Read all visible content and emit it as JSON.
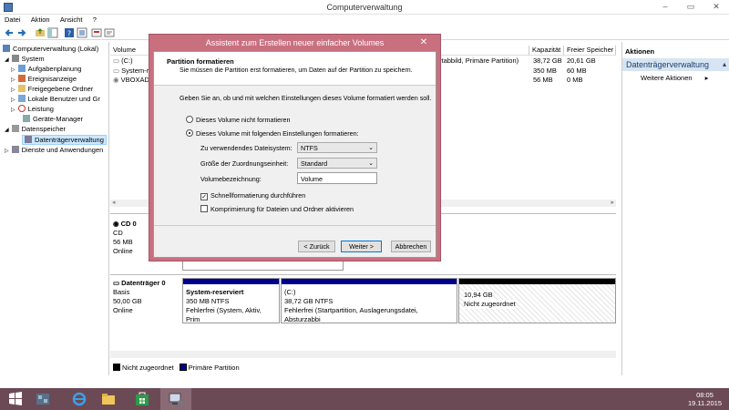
{
  "window": {
    "title": "Computerverwaltung",
    "minimize": "–",
    "maximize": "▭",
    "close": "✕"
  },
  "menu": [
    "Datei",
    "Aktion",
    "Ansicht",
    "?"
  ],
  "tree": {
    "root": "Computerverwaltung (Lokal)",
    "system": "System",
    "items": [
      "Aufgabenplanung",
      "Ereignisanzeige",
      "Freigegebene Ordner",
      "Lokale Benutzer und Gr",
      "Leistung",
      "Geräte-Manager"
    ],
    "storage": "Datenspeicher",
    "disk_mgmt": "Datenträgerverwaltung",
    "services": "Dienste und Anwendungen"
  },
  "volumes": {
    "headers": {
      "volume": "Volume",
      "capacity": "Kapazität",
      "free": "Freier Speicher"
    },
    "rows": [
      {
        "name": "(C:)",
        "status": "rtabbild, Primäre Partition)",
        "capacity": "38,72 GB",
        "free": "20,61 GB"
      },
      {
        "name": "System-r",
        "status": "",
        "capacity": "350 MB",
        "free": "60 MB"
      },
      {
        "name": "VBOXAD",
        "status": "",
        "capacity": "56 MB",
        "free": "0 MB"
      }
    ]
  },
  "cd": {
    "name": "CD 0",
    "type": "CD",
    "size": "56 MB",
    "status": "Online"
  },
  "disk": {
    "name": "Datenträger 0",
    "type": "Basis",
    "size": "50,00 GB",
    "status": "Online",
    "partitions": [
      {
        "name": "System-reserviert",
        "size": "350 MB NTFS",
        "status": "Fehlerfrei (System, Aktiv, Prim"
      },
      {
        "name": "(C:)",
        "size": "38,72 GB NTFS",
        "status": "Fehlerfrei (Startpartition, Auslagerungsdatei, Absturzabbi"
      },
      {
        "name": "",
        "size": "10,94 GB",
        "status": "Nicht zugeordnet"
      }
    ]
  },
  "legend": {
    "unassigned": "Nicht zugeordnet",
    "primary": "Primäre Partition"
  },
  "actions": {
    "header": "Aktionen",
    "section": "Datenträgerverwaltung",
    "more": "Weitere Aktionen"
  },
  "dialog": {
    "title": "Assistent zum Erstellen neuer einfacher Volumes",
    "heading": "Partition formatieren",
    "subheading": "Sie müssen die Partition erst formatieren, um Daten auf der Partition zu speichern.",
    "prompt": "Geben Sie an, ob und mit welchen Einstellungen dieses Volume formatiert werden soll.",
    "radio_noformat": "Dieses Volume nicht formatieren",
    "radio_format": "Dieses Volume mit folgenden Einstellungen formatieren:",
    "fs_label": "Zu verwendendes Dateisystem:",
    "fs_value": "NTFS",
    "alloc_label": "Größe der Zuordnungseinheit:",
    "alloc_value": "Standard",
    "vol_label": "Volumebezeichnung:",
    "vol_value": "Volume",
    "quick_format": "Schnellformatierung durchführen",
    "compress": "Komprimierung für Dateien und Ordner aktivieren",
    "back": "< Zurück",
    "next": "Weiter >",
    "cancel": "Abbrechen"
  },
  "clock": {
    "time": "08:05",
    "date": "19.11.2015"
  },
  "colors": {
    "accent": "#c9707f",
    "taskbar": "#6b4a55",
    "primary_partition": "#00008b",
    "unassigned": "#000000"
  }
}
